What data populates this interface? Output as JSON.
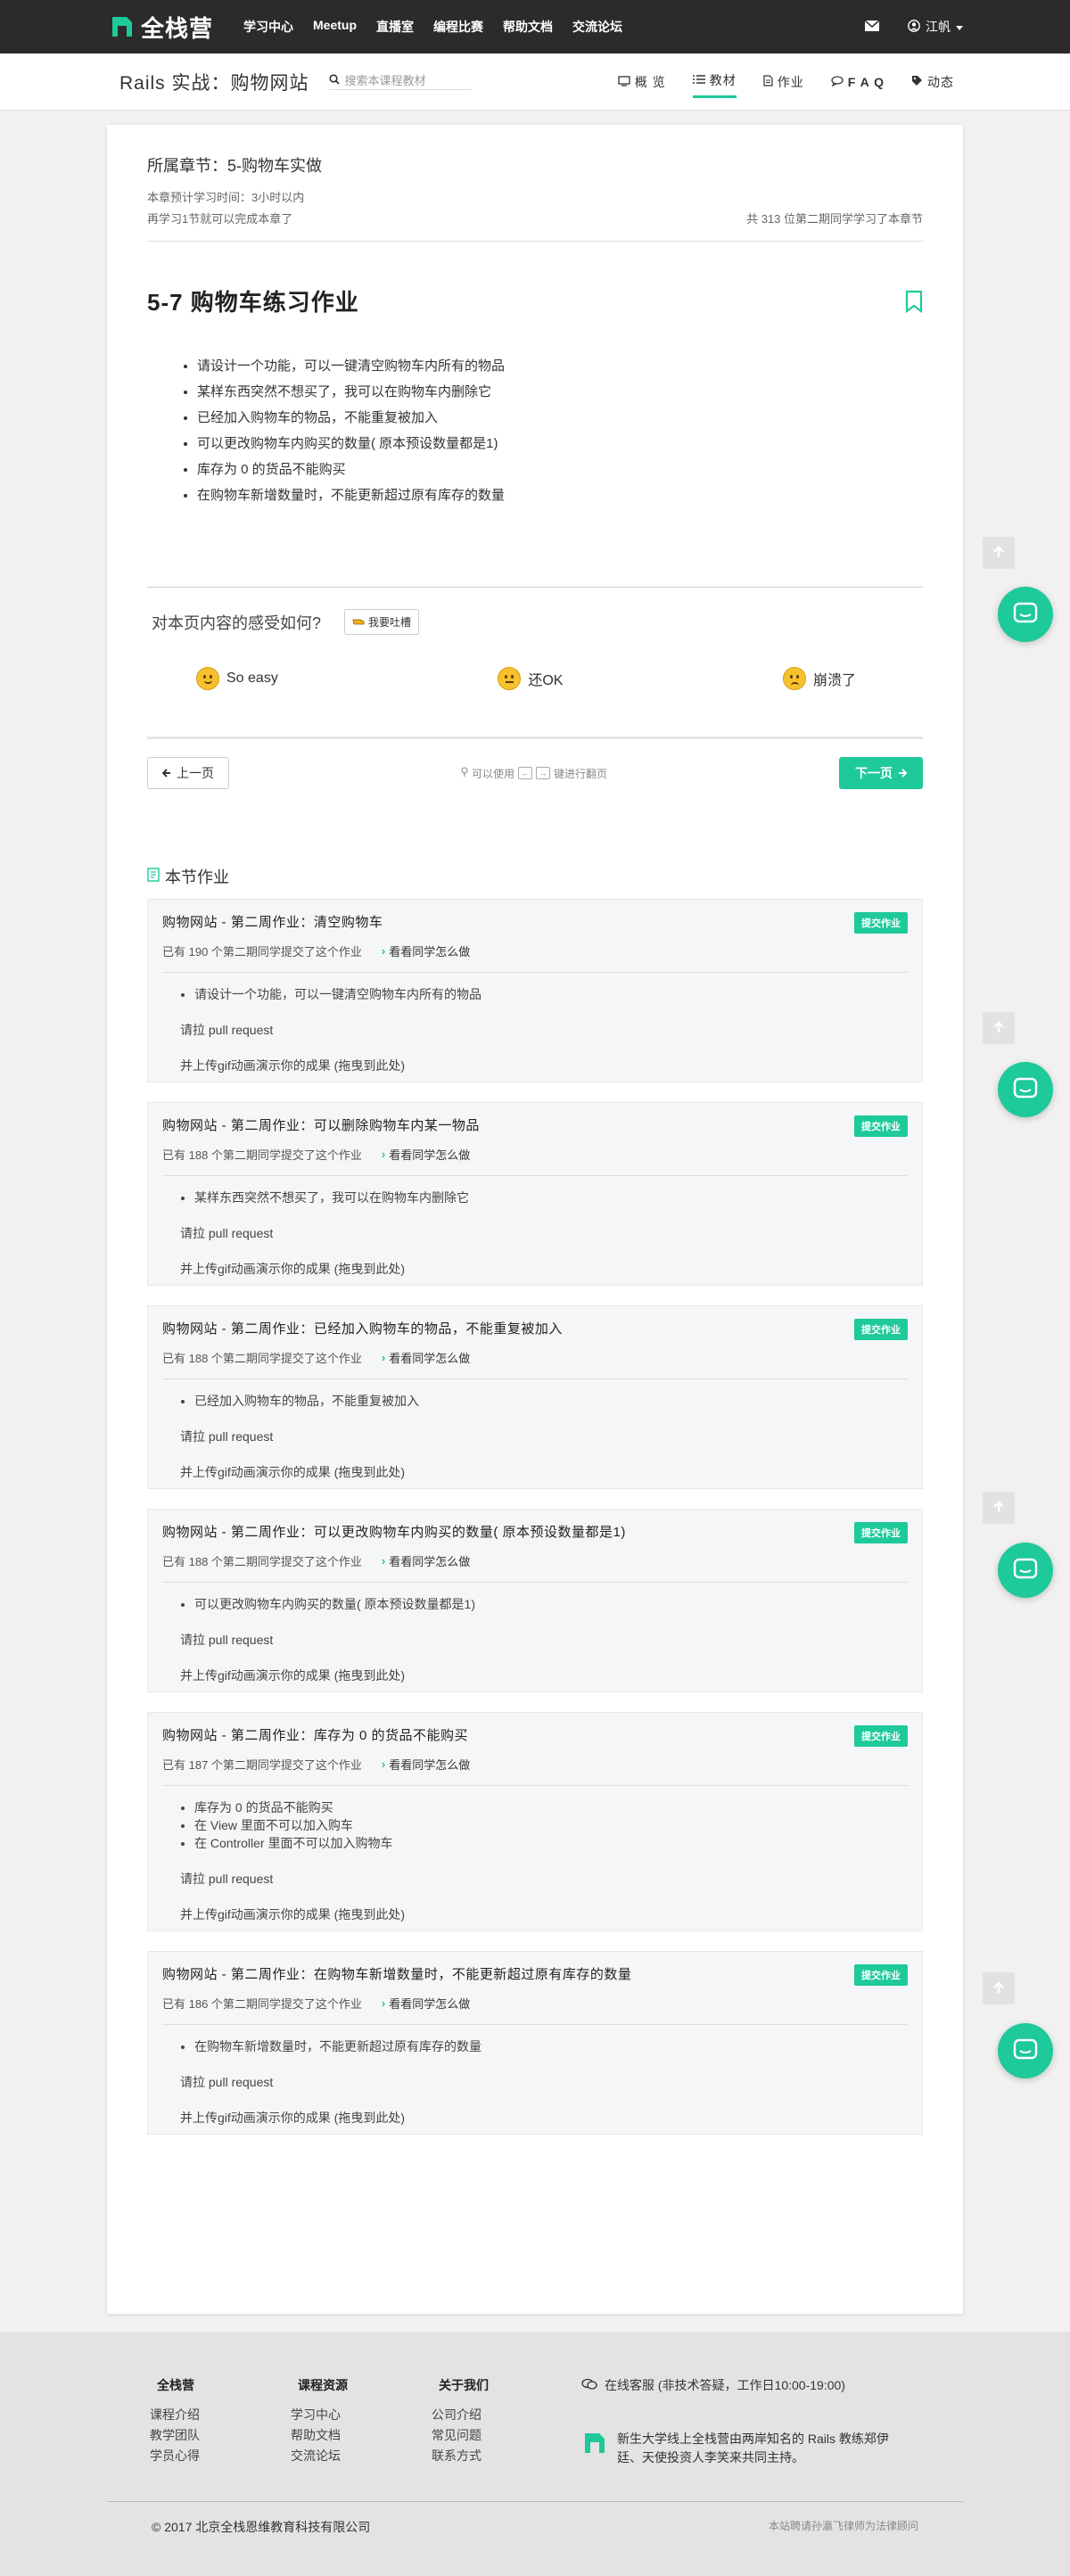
{
  "topbar": {
    "logo_text": "全栈营",
    "nav": [
      "学习中心",
      "Meetup",
      "直播室",
      "编程比赛",
      "帮助文档",
      "交流论坛"
    ],
    "user_name": "江帆"
  },
  "subbar": {
    "course_title": "Rails 实战：购物网站",
    "search_placeholder": "搜索本课程教材",
    "tabs": [
      "概 览",
      "教材",
      "作业",
      "F A Q",
      "动态"
    ]
  },
  "chapter": {
    "name": "所属章节：5-购物车实做",
    "time": "本章预计学习时间：3小时以内",
    "remain": "再学习1节就可以完成本章了",
    "progress": "共 313 位第二期同学学习了本章节"
  },
  "lesson": {
    "title": "5-7 购物车练习作业",
    "items": [
      "请设计一个功能，可以一键清空购物车内所有的物品",
      "某样东西突然不想买了，我可以在购物车内删除它",
      "已经加入购物车的物品，不能重复被加入",
      "可以更改购物车内购买的数量( 原本预设数量都是1)",
      "库存为 0 的货品不能购买",
      "在购物车新增数量时，不能更新超过原有库存的数量"
    ]
  },
  "feedback": {
    "question": "对本页内容的感受如何?",
    "button": "我要吐槽",
    "options": [
      "So easy",
      "还OK",
      "崩溃了"
    ]
  },
  "pager": {
    "prev": "上一页",
    "hint_a": "可以使用",
    "key_left": "←",
    "key_right": "→",
    "hint_b": "键进行翻页",
    "next": "下一页"
  },
  "homework": {
    "section_title": "本节作业",
    "submit_label": "提交作业",
    "see_label": "看看同学怎么做",
    "pr_line": "请拉 pull request",
    "gif_line": "并上传gif动画演示你的成果 (拖曳到此处)",
    "cards": [
      {
        "title": "购物网站 - 第二周作业：清空购物车",
        "count": "已有 190 个第二期同学提交了这个作业",
        "bullets": [
          "请设计一个功能，可以一键清空购物车内所有的物品"
        ]
      },
      {
        "title": "购物网站 - 第二周作业：可以删除购物车内某一物品",
        "count": "已有 188 个第二期同学提交了这个作业",
        "bullets": [
          "某样东西突然不想买了，我可以在购物车内删除它"
        ]
      },
      {
        "title": "购物网站 - 第二周作业：已经加入购物车的物品，不能重复被加入",
        "count": "已有 188 个第二期同学提交了这个作业",
        "bullets": [
          "已经加入购物车的物品，不能重复被加入"
        ]
      },
      {
        "title": "购物网站 - 第二周作业：可以更改购物车内购买的数量( 原本预设数量都是1)",
        "count": "已有 188 个第二期同学提交了这个作业",
        "bullets": [
          "可以更改购物车内购买的数量( 原本预设数量都是1)"
        ]
      },
      {
        "title": "购物网站 - 第二周作业：库存为 0 的货品不能购买",
        "count": "已有 187 个第二期同学提交了这个作业",
        "bullets": [
          "库存为 0 的货品不能购买",
          "在 View 里面不可以加入购车",
          "在 Controller 里面不可以加入购物车"
        ]
      },
      {
        "title": "购物网站 - 第二周作业：在购物车新增数量时，不能更新超过原有库存的数量",
        "count": "已有 186 个第二期同学提交了这个作业",
        "bullets": [
          "在购物车新增数量时，不能更新超过原有库存的数量"
        ]
      }
    ]
  },
  "footer": {
    "cols": [
      {
        "title": "全栈营",
        "links": [
          "课程介绍",
          "教学团队",
          "学员心得"
        ]
      },
      {
        "title": "课程资源",
        "links": [
          "学习中心",
          "帮助文档",
          "交流论坛"
        ]
      },
      {
        "title": "关于我们",
        "links": [
          "公司介绍",
          "常见问题",
          "联系方式"
        ]
      }
    ],
    "service": "在线客服 (非技术答疑，工作日10:00-19:00)",
    "slogan": "新生大学线上全栈营由两岸知名的 Rails 教练郑伊廷、天使投资人李笑来共同主持。",
    "copyright": "© 2017 北京全栈恩维教育科技有限公司",
    "legal": "本站聘请孙瀛飞律师为法律顾问"
  },
  "colors": {
    "accent": "#1ec99a",
    "topbar": "#2b2b2b"
  },
  "icons": [
    "logo-icon",
    "mail-icon",
    "user-icon",
    "search-icon",
    "monitor-icon",
    "list-icon",
    "doc-icon",
    "chat-icon",
    "tag-icon",
    "bookmark-icon",
    "hand-icon",
    "arrow-left-icon",
    "pin-icon",
    "arrow-right-icon",
    "homework-icon",
    "chevron-right-icon",
    "arrow-up-icon",
    "chat-bubble-icon",
    "service-icon"
  ]
}
